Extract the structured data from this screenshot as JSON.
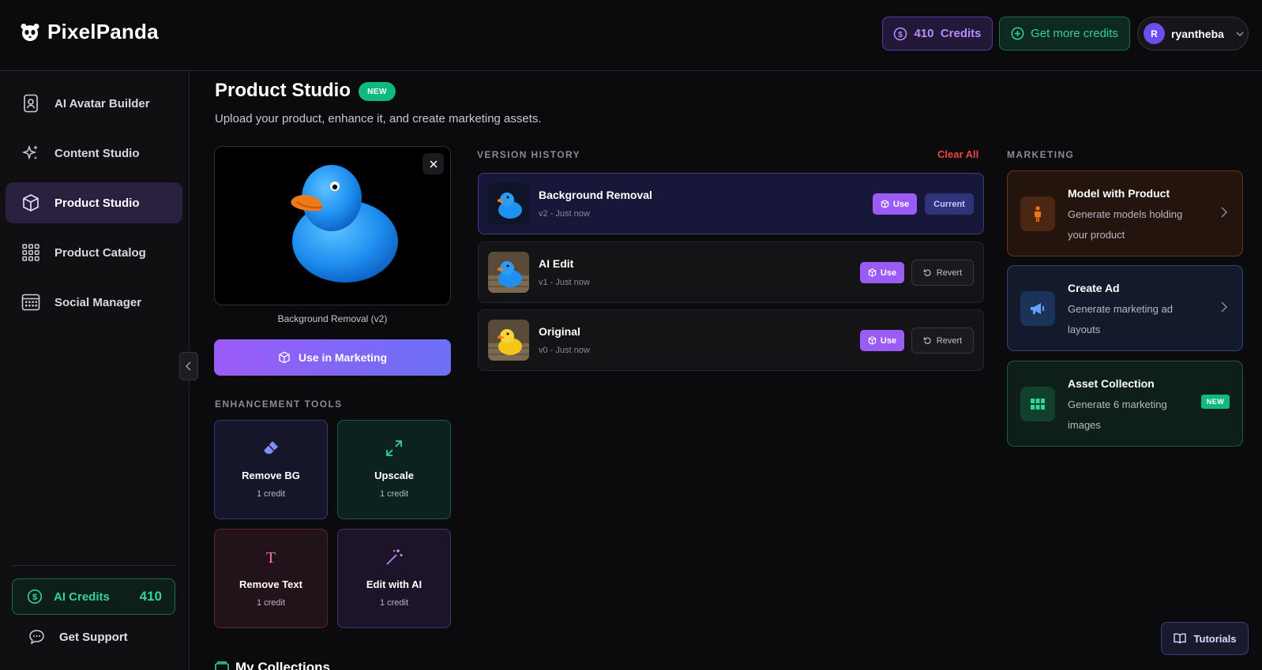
{
  "app": {
    "name": "PixelPanda"
  },
  "header": {
    "credits_label": "410  Credits",
    "get_more_label": "Get more credits",
    "user_initial": "R",
    "username": "ryantheba"
  },
  "sidebar": {
    "items": [
      {
        "label": "AI Avatar Builder",
        "icon": "id-badge-icon"
      },
      {
        "label": "Content Studio",
        "icon": "sparkles-icon"
      },
      {
        "label": "Product Studio",
        "icon": "box-icon",
        "active": true
      },
      {
        "label": "Product Catalog",
        "icon": "grid-icon"
      },
      {
        "label": "Social Manager",
        "icon": "calendar-icon"
      }
    ],
    "credits_label": "AI Credits",
    "credits_value": "410",
    "support_label": "Get Support"
  },
  "page": {
    "title": "Product Studio",
    "badge": "NEW",
    "subtitle": "Upload your product, enhance it, and create marketing assets."
  },
  "preview": {
    "caption": "Background Removal (v2)",
    "use_button": "Use in Marketing"
  },
  "enhancement": {
    "heading": "ENHANCEMENT TOOLS",
    "tools": [
      {
        "name": "Remove BG",
        "cost": "1 credit",
        "icon": "eraser-icon",
        "color": "#818cf8"
      },
      {
        "name": "Upscale",
        "cost": "1 credit",
        "icon": "expand-icon",
        "color": "#34d399"
      },
      {
        "name": "Remove Text",
        "cost": "1 credit",
        "icon": "text-icon",
        "color": "#f472b6"
      },
      {
        "name": "Edit with AI",
        "cost": "1 credit",
        "icon": "magic-wand-icon",
        "color": "#c084fc"
      }
    ]
  },
  "history": {
    "heading": "VERSION HISTORY",
    "clear_label": "Clear All",
    "use_label": "Use",
    "current_label": "Current",
    "revert_label": "Revert",
    "versions": [
      {
        "name": "Background Removal",
        "meta": "v2 - Just now"
      },
      {
        "name": "AI Edit",
        "meta": "v1 - Just now"
      },
      {
        "name": "Original",
        "meta": "v0 - Just now"
      }
    ]
  },
  "marketing": {
    "heading": "MARKETING",
    "cards": [
      {
        "title": "Model with Product",
        "desc": "Generate models holding your product",
        "icon": "person-icon",
        "accent": "#f97316"
      },
      {
        "title": "Create Ad",
        "desc": "Generate marketing ad layouts",
        "icon": "megaphone-icon",
        "accent": "#60a5fa"
      },
      {
        "title": "Asset Collection",
        "desc": "Generate 6 marketing images",
        "icon": "grid-icon",
        "accent": "#34d399",
        "badge": "NEW"
      }
    ]
  },
  "footer": {
    "tutorials_label": "Tutorials",
    "collections_title": "My Collections"
  }
}
